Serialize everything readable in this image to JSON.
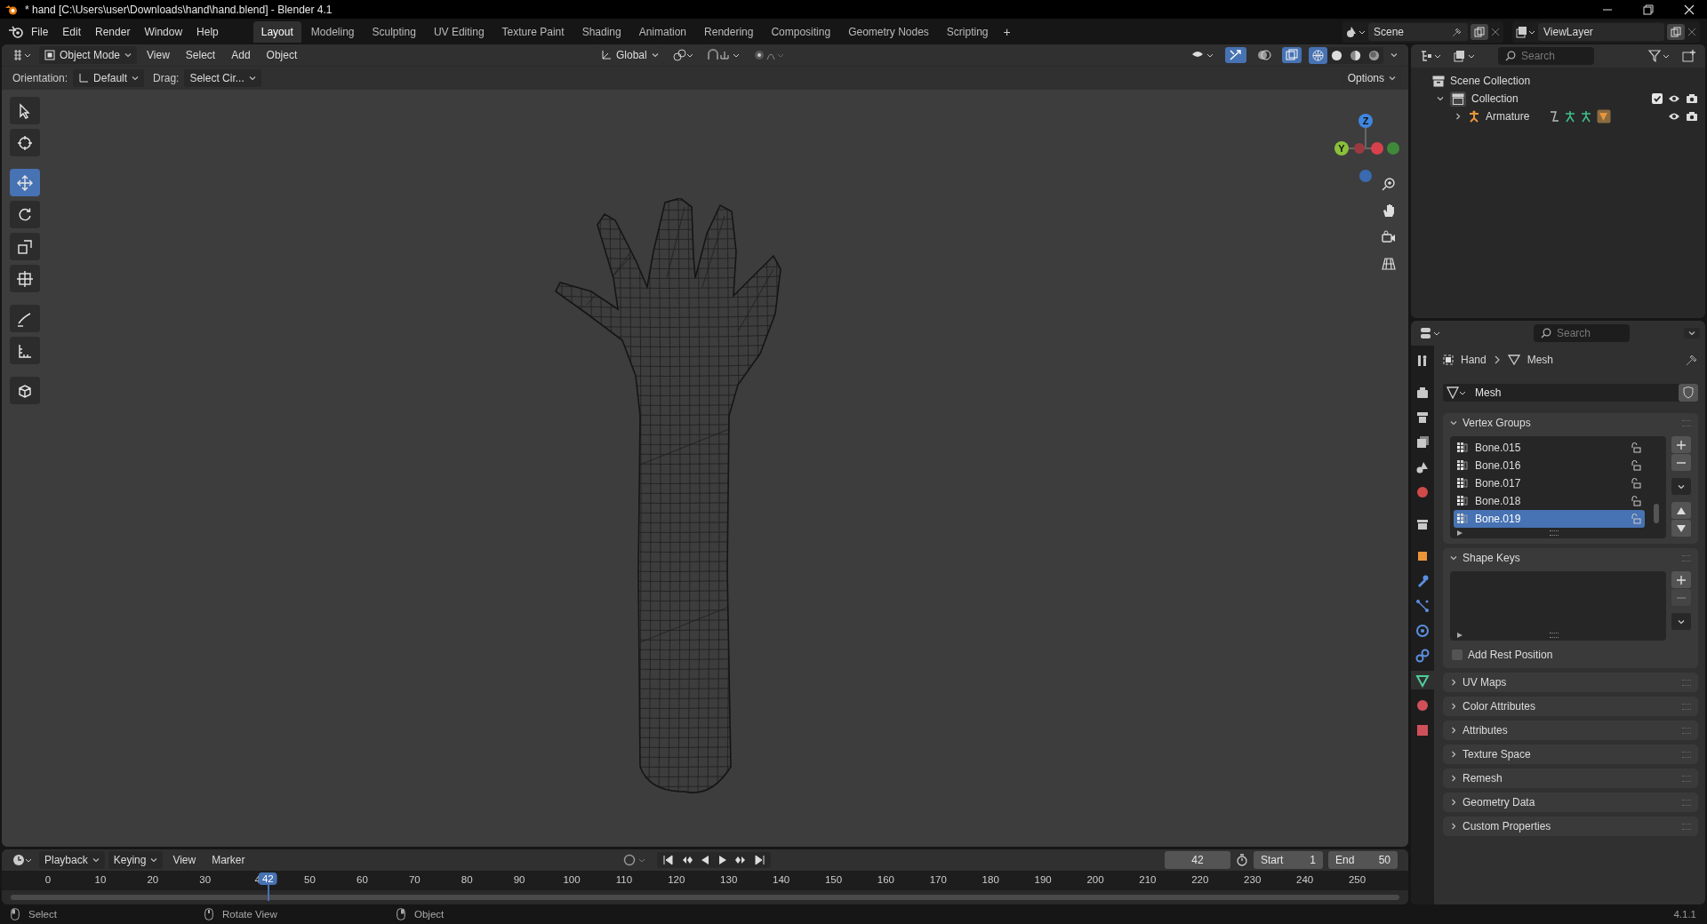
{
  "window": {
    "title": "* hand [C:\\Users\\user\\Downloads\\hand\\hand.blend] - Blender 4.1"
  },
  "menu": [
    "File",
    "Edit",
    "Render",
    "Window",
    "Help"
  ],
  "workspaces": [
    {
      "label": "Layout",
      "selected": true
    },
    {
      "label": "Modeling",
      "selected": false
    },
    {
      "label": "Sculpting",
      "selected": false
    },
    {
      "label": "UV Editing",
      "selected": false
    },
    {
      "label": "Texture Paint",
      "selected": false
    },
    {
      "label": "Shading",
      "selected": false
    },
    {
      "label": "Animation",
      "selected": false
    },
    {
      "label": "Rendering",
      "selected": false
    },
    {
      "label": "Compositing",
      "selected": false
    },
    {
      "label": "Geometry Nodes",
      "selected": false
    },
    {
      "label": "Scripting",
      "selected": false
    }
  ],
  "add_workspace": "+",
  "scene": {
    "name": "Scene"
  },
  "view_layer": {
    "name": "ViewLayer"
  },
  "viewport": {
    "mode": "Object Mode",
    "menus": [
      "View",
      "Select",
      "Add",
      "Object"
    ],
    "transform_orientation": "Global",
    "orientation_label": "Orientation:",
    "orientation": "Default",
    "drag_label": "Drag:",
    "drag": "Select Cir...",
    "options": "Options",
    "shading_modes": [
      {
        "kind": "wireframe",
        "selected": true
      },
      {
        "kind": "solid",
        "selected": false
      },
      {
        "kind": "material",
        "selected": false
      },
      {
        "kind": "rendered",
        "selected": false
      }
    ],
    "tools": [
      {
        "kind": "tweak",
        "selected": false
      },
      {
        "kind": "cursor",
        "selected": false
      },
      {
        "kind": "move",
        "selected": true
      },
      {
        "kind": "rotate",
        "selected": false
      },
      {
        "kind": "scale",
        "selected": false
      },
      {
        "kind": "transform",
        "selected": false
      },
      {
        "kind": "annotate",
        "selected": false
      },
      {
        "kind": "measure",
        "selected": false
      },
      {
        "kind": "add_cube",
        "selected": false
      }
    ],
    "gizmo": {
      "z_label": "Z",
      "y_label": "Y"
    }
  },
  "outliner": {
    "search_placeholder": "Search",
    "tree": [
      {
        "label": "Scene Collection",
        "kind": "scene",
        "children": [
          {
            "label": "Collection",
            "kind": "collection",
            "expanded": true,
            "checked": true,
            "children": [
              {
                "label": "Armature",
                "kind": "armature",
                "expanded": false
              }
            ]
          }
        ]
      }
    ]
  },
  "properties": {
    "search_placeholder": "Search",
    "tabs": [
      {
        "kind": "tool",
        "selected": false
      },
      {
        "kind": "render",
        "selected": false
      },
      {
        "kind": "output",
        "selected": false
      },
      {
        "kind": "view_layer",
        "selected": false
      },
      {
        "kind": "scene",
        "selected": false
      },
      {
        "kind": "world",
        "selected": false
      },
      {
        "kind": "collection",
        "selected": false
      },
      {
        "kind": "object",
        "selected": false
      },
      {
        "kind": "modifiers",
        "selected": false
      },
      {
        "kind": "particles",
        "selected": false
      },
      {
        "kind": "physics",
        "selected": false
      },
      {
        "kind": "constraints",
        "selected": false
      },
      {
        "kind": "data",
        "selected": true
      },
      {
        "kind": "material",
        "selected": false
      },
      {
        "kind": "texture",
        "selected": false
      }
    ],
    "breadcrumb": [
      "Hand",
      "Mesh"
    ],
    "mesh_name": "Mesh",
    "vertex_groups": {
      "title": "Vertex Groups",
      "expanded": true,
      "items": [
        {
          "name": "Bone.015",
          "selected": false
        },
        {
          "name": "Bone.016",
          "selected": false
        },
        {
          "name": "Bone.017",
          "selected": false
        },
        {
          "name": "Bone.018",
          "selected": false
        },
        {
          "name": "Bone.019",
          "selected": true
        }
      ]
    },
    "shape_keys": {
      "title": "Shape Keys",
      "expanded": true
    },
    "add_rest_position": {
      "label": "Add Rest Position",
      "checked": false
    },
    "panels": [
      {
        "title": "UV Maps",
        "expanded": false
      },
      {
        "title": "Color Attributes",
        "expanded": false
      },
      {
        "title": "Attributes",
        "expanded": false
      },
      {
        "title": "Texture Space",
        "expanded": false
      },
      {
        "title": "Remesh",
        "expanded": false
      },
      {
        "title": "Geometry Data",
        "expanded": false
      },
      {
        "title": "Custom Properties",
        "expanded": false
      }
    ]
  },
  "timeline": {
    "menus": [
      "Playback",
      "Keying",
      "View",
      "Marker"
    ],
    "current_frame": "42",
    "playhead_frame": "42",
    "start_label": "Start",
    "start": "1",
    "end_label": "End",
    "end": "50",
    "ticks": [
      "0",
      "10",
      "20",
      "30",
      "4",
      "50",
      "60",
      "70",
      "80",
      "90",
      "100",
      "110",
      "120",
      "130",
      "140",
      "150",
      "160",
      "170",
      "180",
      "190",
      "200",
      "210",
      "220",
      "230",
      "240",
      "250"
    ]
  },
  "status_bar": {
    "hints": [
      {
        "kind": "left_click",
        "label": "Select"
      },
      {
        "kind": "middle_click",
        "label": "Rotate View"
      },
      {
        "kind": "right_click",
        "label": "Object"
      }
    ],
    "version": "4.1.1"
  }
}
